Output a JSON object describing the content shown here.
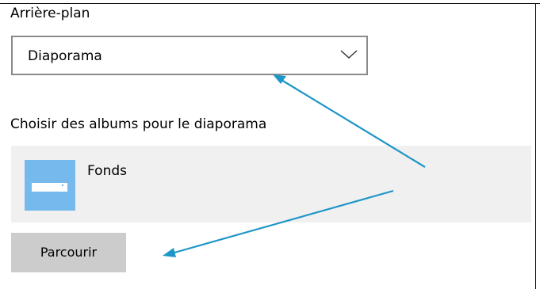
{
  "background_section": {
    "heading": "Arrière-plan",
    "dropdown": {
      "selected_value": "Diaporama",
      "chevron_icon": "chevron-down-icon"
    }
  },
  "albums_section": {
    "heading": "Choisir des albums pour le diaporama",
    "albums": [
      {
        "name": "Fonds",
        "thumbnail_icon": "folder-icon"
      }
    ],
    "browse_button_label": "Parcourir"
  },
  "annotation": {
    "arrow_color": "#1e96c8"
  },
  "colors": {
    "dropdown_border": "#8a8a8a",
    "album_row_background": "#f0f0f0",
    "album_thumbnail": "#76b9ed",
    "button_background": "#cccccc"
  }
}
